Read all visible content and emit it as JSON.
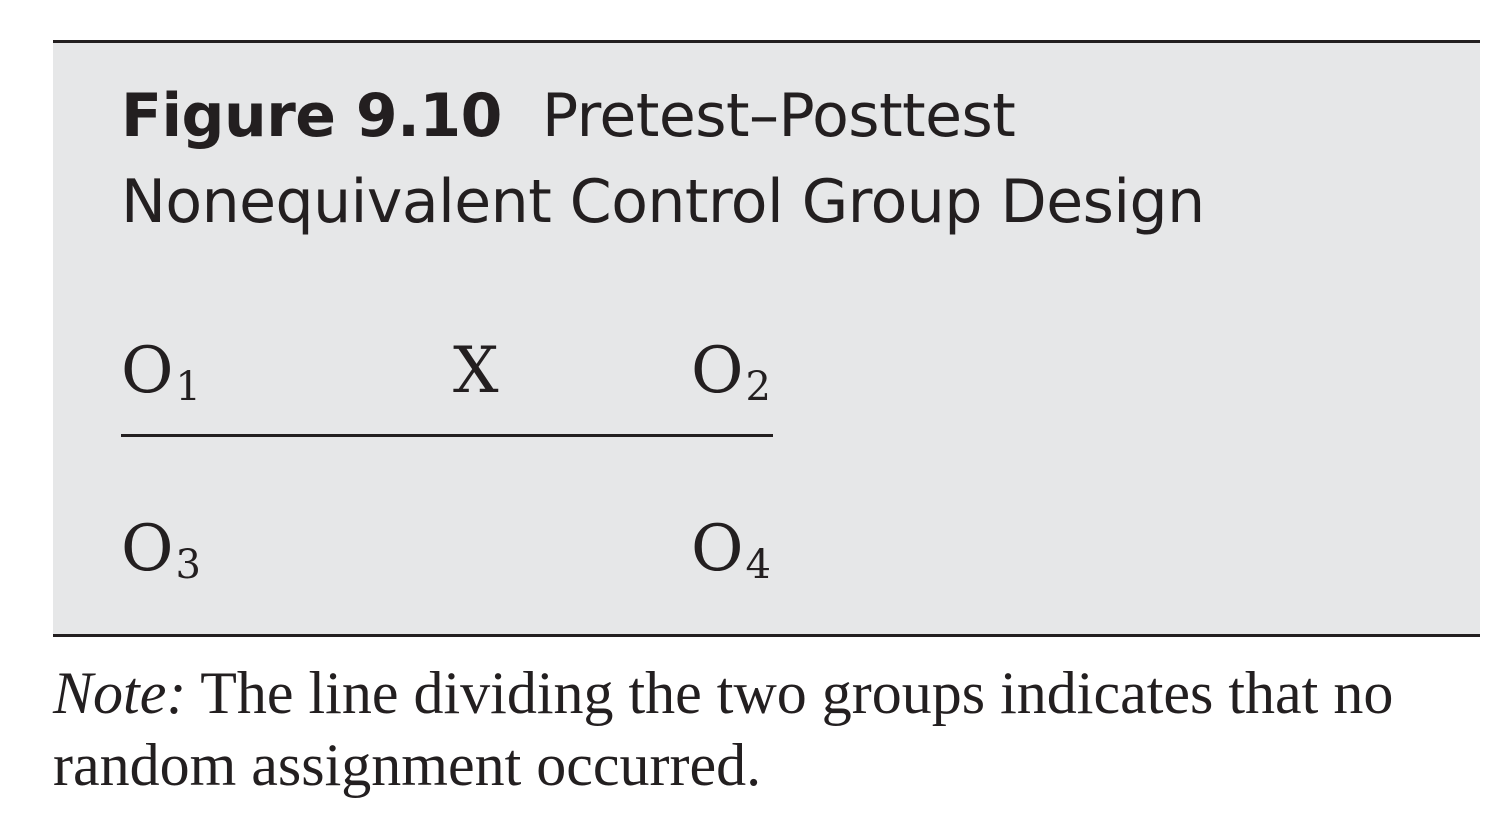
{
  "figure": {
    "number": "Figure 9.10",
    "title": "Pretest–Posttest Nonequivalent Control Group Design"
  },
  "design": {
    "group1": {
      "pretest": {
        "symbol": "O",
        "index": "1"
      },
      "treatment": "X",
      "posttest": {
        "symbol": "O",
        "index": "2"
      }
    },
    "group2": {
      "pretest": {
        "symbol": "O",
        "index": "3"
      },
      "posttest": {
        "symbol": "O",
        "index": "4"
      }
    }
  },
  "note": {
    "label": "Note:",
    "text": "The line dividing the two groups indicates that no random assignment occurred."
  }
}
